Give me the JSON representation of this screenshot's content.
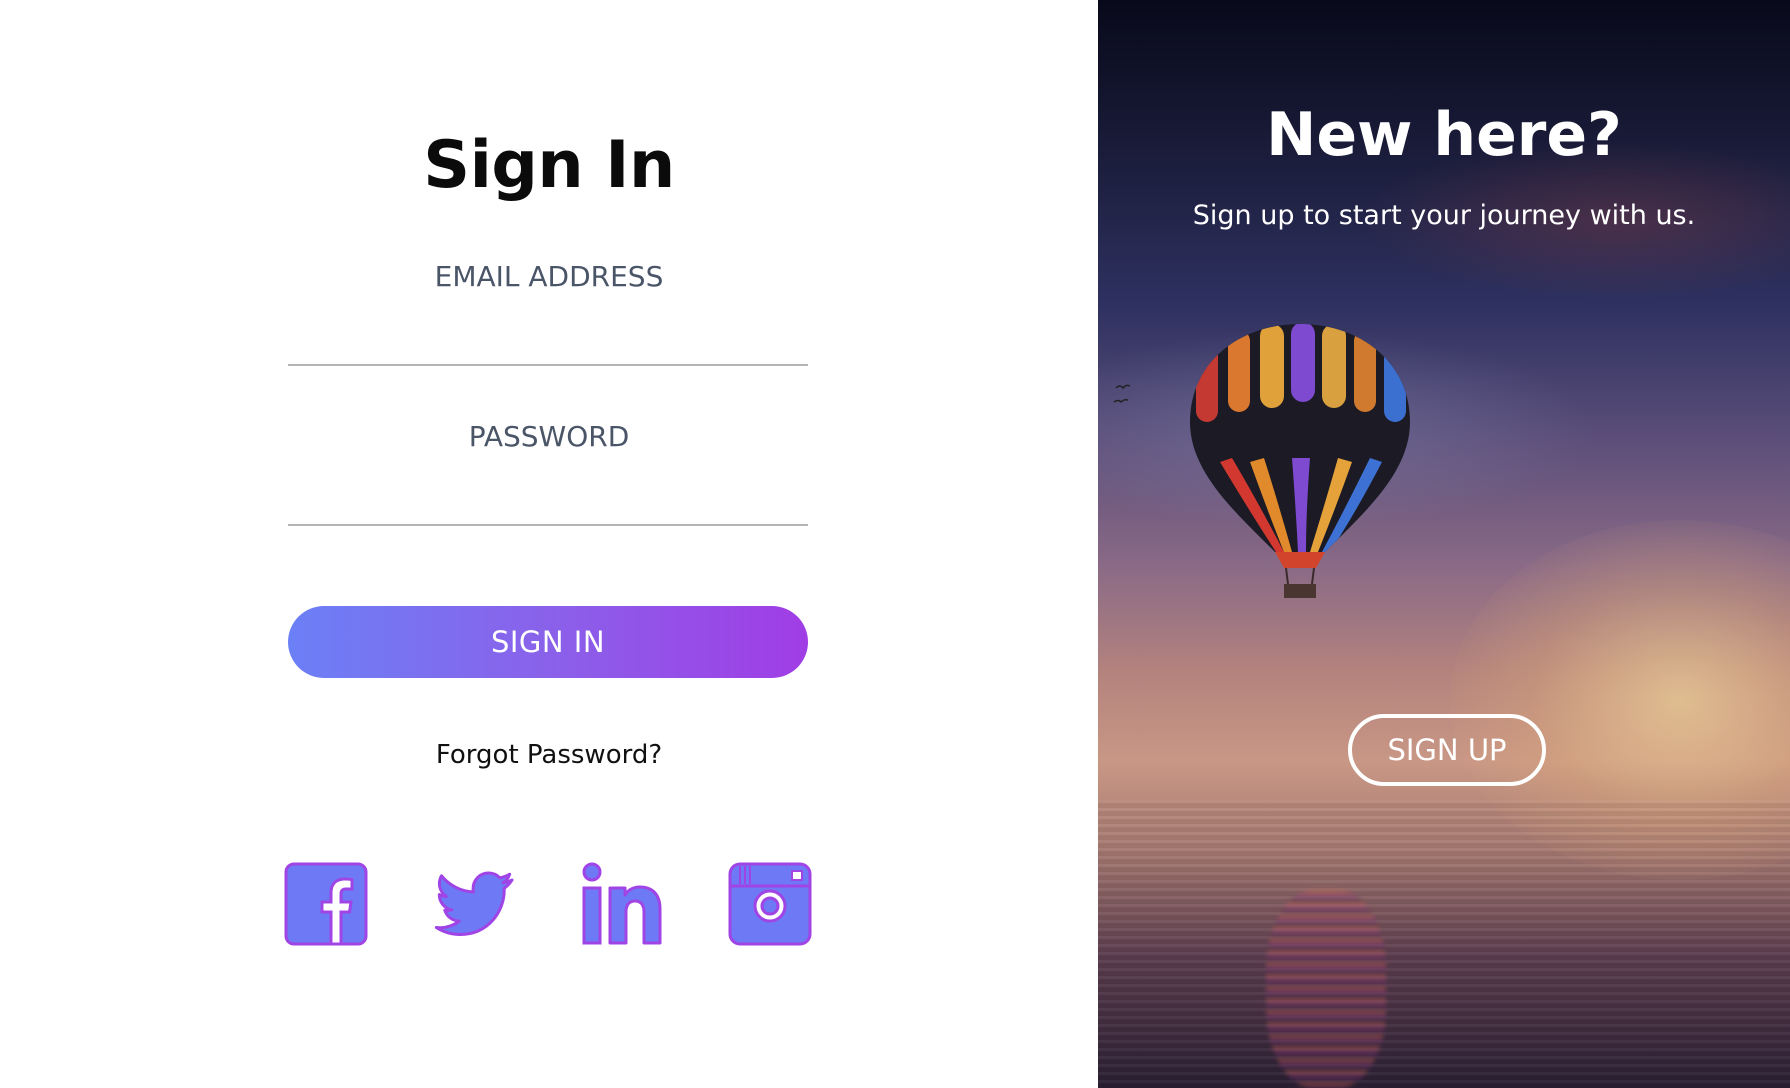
{
  "signin": {
    "title": "Sign In",
    "email_label": "EMAIL ADDRESS",
    "email_value": "",
    "password_label": "PASSWORD",
    "password_value": "",
    "button_label": "SIGN IN",
    "forgot_label": "Forgot Password?",
    "social_icons": [
      "facebook-icon",
      "twitter-icon",
      "linkedin-icon",
      "instagram-icon"
    ]
  },
  "signup_panel": {
    "title": "New here?",
    "subtitle": "Sign up to start your journey with us.",
    "button_label": "SIGN UP"
  },
  "colors": {
    "accent_start": "#6b80f6",
    "accent_end": "#a03de5",
    "icon_fill": "#6e7af5",
    "icon_stroke": "#a044e6"
  }
}
